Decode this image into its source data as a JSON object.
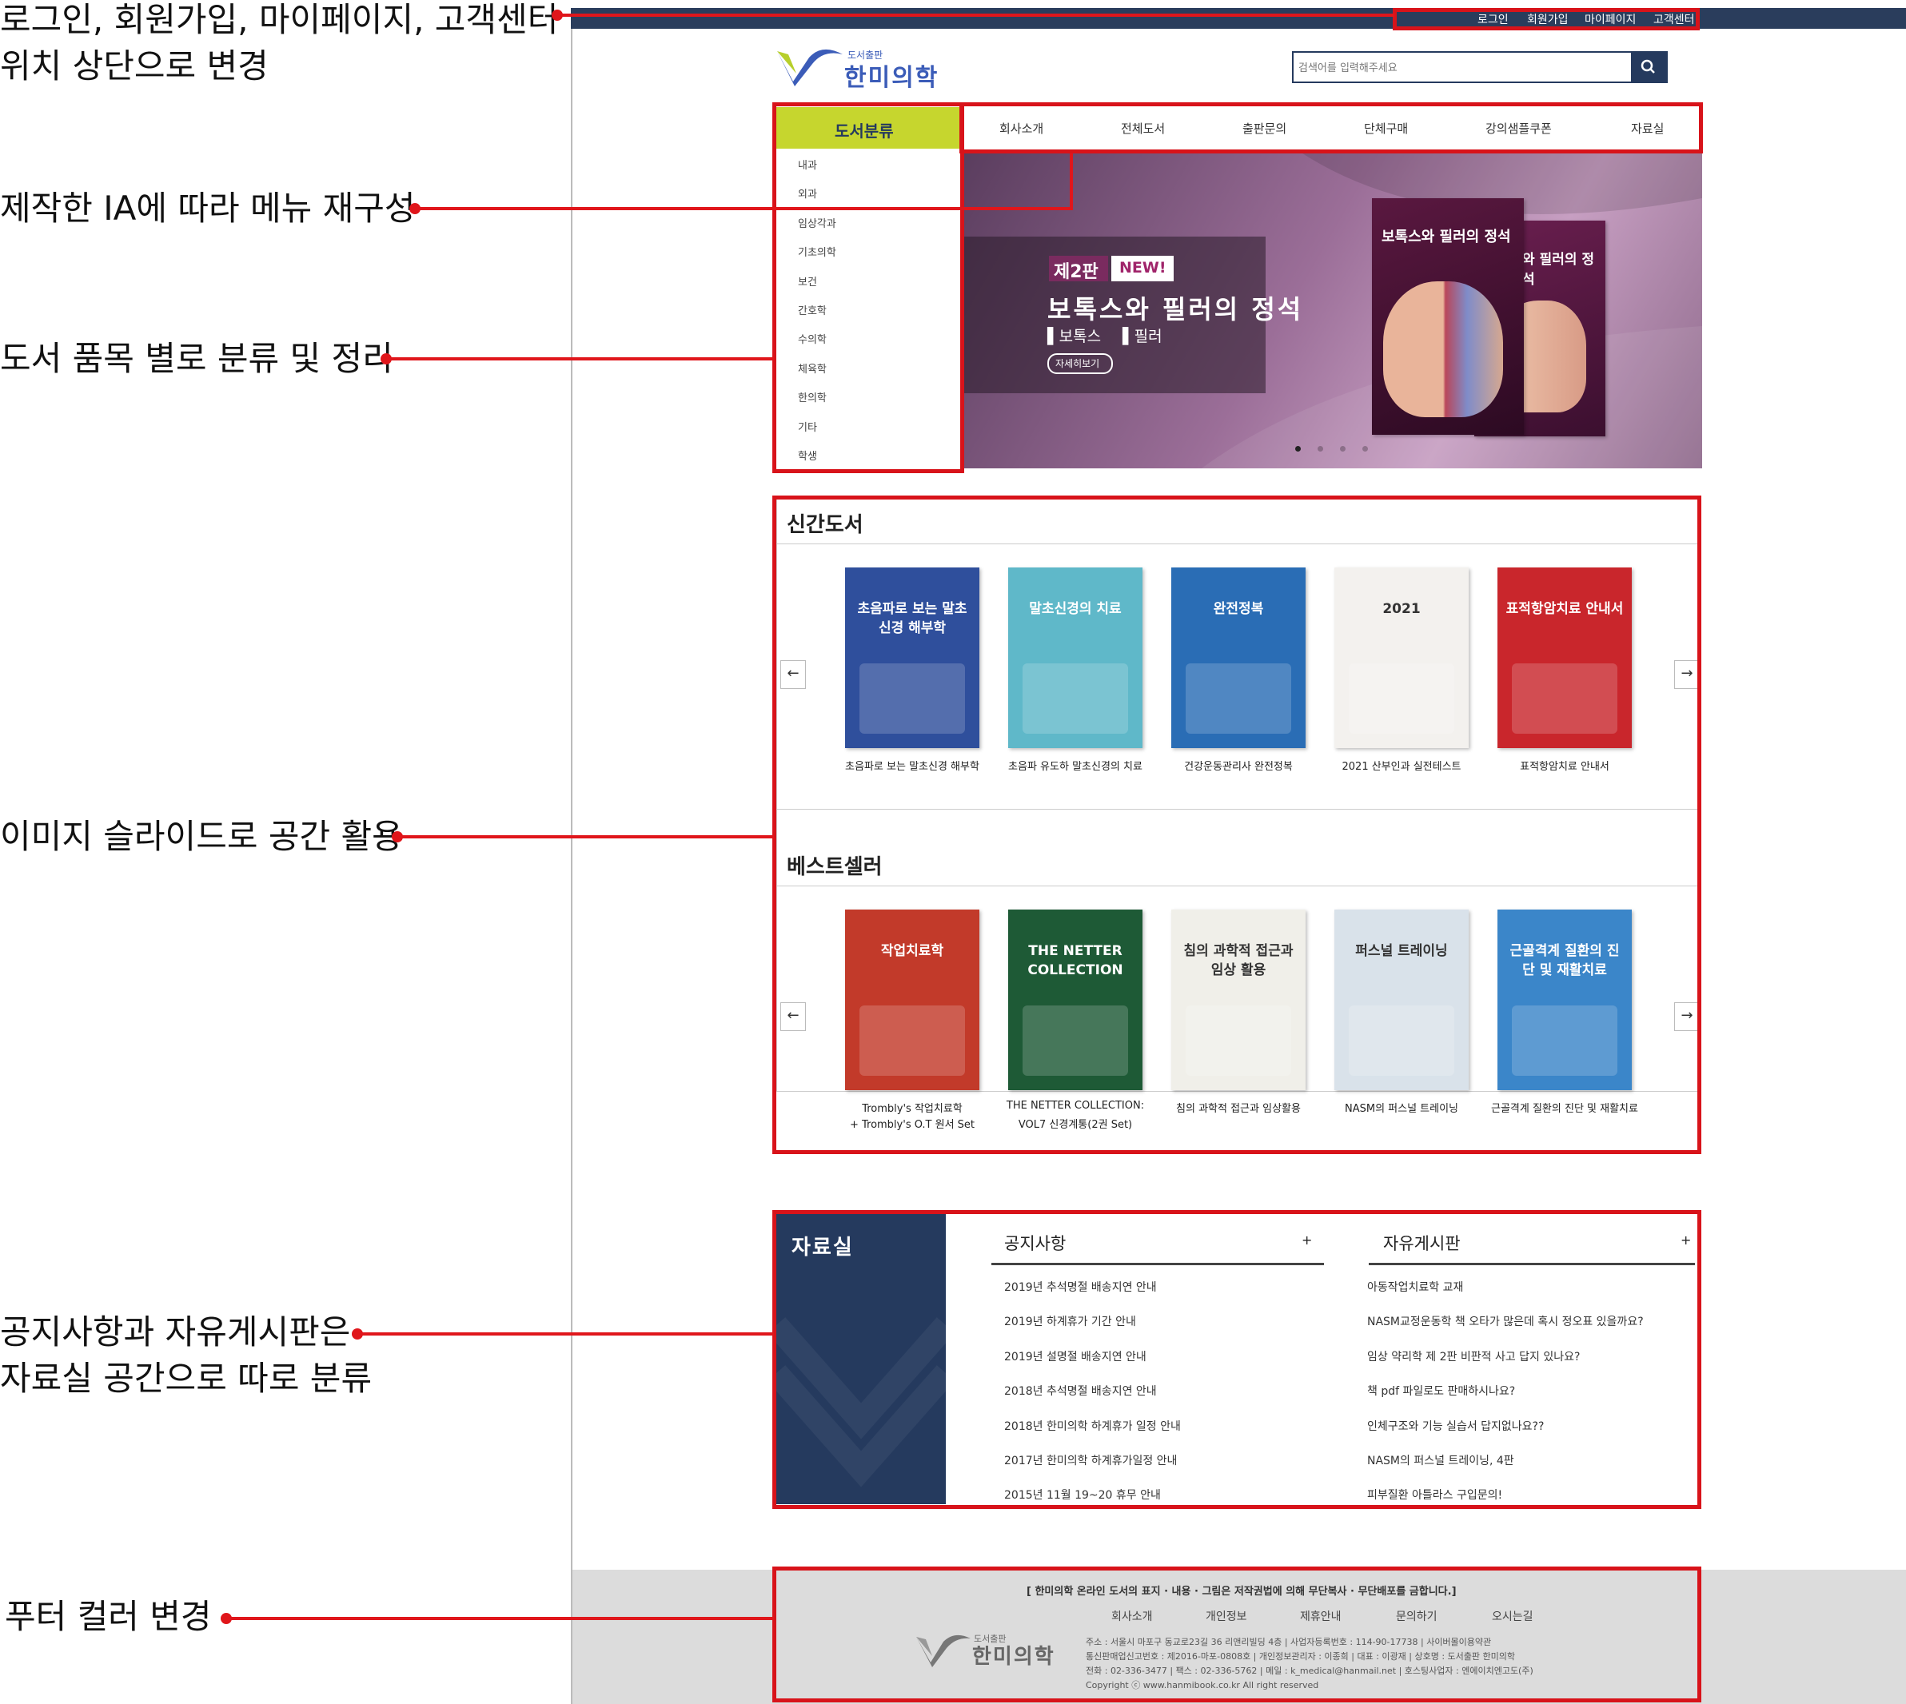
{
  "annotations": [
    {
      "lines": [
        "로그인, 회원가입, 마이페이지, 고객센터",
        "위치 상단으로 변경"
      ]
    },
    {
      "lines": [
        "제작한 IA에 따라 메뉴 재구성"
      ]
    },
    {
      "lines": [
        "도서 품목 별로 분류 및 정리"
      ]
    },
    {
      "lines": [
        "이미지 슬라이드로 공간 활용"
      ]
    },
    {
      "lines": [
        "공지사항과 자유게시판은",
        "자료실 공간으로 따로 분류"
      ]
    },
    {
      "lines": [
        "푸터 컬러 변경"
      ]
    }
  ],
  "top_links": [
    "로그인",
    "회원가입",
    "마이페이지",
    "고객센터"
  ],
  "logo": {
    "small": "도서출판",
    "main": "한미의학"
  },
  "search": {
    "placeholder": "검색어를 입력해주세요"
  },
  "category_header": "도서분류",
  "nav": [
    "회사소개",
    "전체도서",
    "출판문의",
    "단체구매",
    "강의샘플쿠폰",
    "자료실"
  ],
  "categories": [
    {
      "label": "내과",
      "plus": true
    },
    {
      "label": "외과",
      "plus": true
    },
    {
      "label": "임상각과",
      "plus": true
    },
    {
      "label": "기초의학",
      "plus": true
    },
    {
      "label": "보건",
      "plus": true
    },
    {
      "label": "간호학",
      "plus": false
    },
    {
      "label": "수의학",
      "plus": false
    },
    {
      "label": "체육학",
      "plus": true
    },
    {
      "label": "한의학",
      "plus": false
    },
    {
      "label": "기타",
      "plus": true
    },
    {
      "label": "학생",
      "plus": true
    }
  ],
  "banner": {
    "edition": "제2판",
    "new_badge": "NEW!",
    "title": "보톡스와 필러의 정석",
    "sub1": "보톡스",
    "sub2": "필러",
    "button": "자세히보기",
    "book_front_title": "보톡스와 필러의 정석",
    "book_back_title": "와 필러의 정석",
    "active_slide": 1,
    "slide_count": 4
  },
  "new_books": {
    "title": "신간도서",
    "items": [
      {
        "title": "초음파로 보는 말초신경 해부학",
        "cover_text": "초음파로 보는 말초신경 해부학",
        "color": "#2f4f9c"
      },
      {
        "title": "초음파 유도하 말초신경의 치료",
        "cover_text": "말초신경의 치료",
        "color": "#5fb8c9"
      },
      {
        "title": "건강운동관리사 완전정복",
        "cover_text": "완전정복",
        "color": "#2a6db5"
      },
      {
        "title": "2021 산부인과 실전테스트",
        "cover_text": "2021",
        "color": "#f3f1ee"
      },
      {
        "title": "표적항암치료 안내서",
        "cover_text": "표적항암치료 안내서",
        "color": "#c9262c"
      }
    ]
  },
  "best_books": {
    "title": "베스트셀러",
    "items": [
      {
        "title_line1": "Trombly's 작업치료학",
        "title_line2": "+ Trombly's O.T 원서 Set",
        "cover_text": "작업치료학",
        "color": "#c23a2a"
      },
      {
        "title_line1": "THE NETTER COLLECTION:",
        "title_line2": "VOL7 신경계통(2권 Set)",
        "cover_text": "THE NETTER COLLECTION",
        "color": "#1e5a36"
      },
      {
        "title_line1": "침의 과학적 접근과 임상활용",
        "title_line2": "",
        "cover_text": "침의 과학적 접근과 임상 활용",
        "color": "#f0efe9"
      },
      {
        "title_line1": "NASM의 퍼스널 트레이닝",
        "title_line2": "",
        "cover_text": "퍼스널 트레이닝",
        "color": "#d9e2ea"
      },
      {
        "title_line1": "근골격계 질환의 진단 및 재활치료",
        "title_line2": "",
        "cover_text": "근골격계 질환의 진단 및 재활치료",
        "color": "#3b86c9"
      }
    ]
  },
  "archive": {
    "title": "자료실",
    "notice_title": "공지사항",
    "board_title": "자유게시판",
    "more": "+",
    "notices": [
      "2019년 추석명절 배송지연 안내",
      "2019년 하계휴가 기간 안내",
      "2019년 설명절 배송지연 안내",
      "2018년 추석명절 배송지연 안내",
      "2018년 한미의학 하계휴가 일정 안내",
      "2017년 한미의학 하계휴가일정 안내",
      "2015년 11월 19~20 휴무 안내"
    ],
    "posts": [
      "아동작업치료학 교재",
      "NASM교정운동학 책 오타가 많은데 혹시 정오표 있을까요?",
      "임상 약리학 제 2판 비판적 사고 답지 있나요?",
      "책 pdf 파일로도 판매하시나요?",
      "인체구조와 기능 실습서 답지없나요??",
      "NASM의 퍼스널 트레이닝, 4판",
      "피부질환 아틀라스 구입문의!"
    ]
  },
  "footer": {
    "notice": "[ 한미의학 온라인 도서의 표지 · 내용 · 그림은 저작권법에 의해 무단복사 · 무단배포를 금합니다.]",
    "links": [
      "회사소개",
      "개인정보",
      "제휴안내",
      "문의하기",
      "오시는길"
    ],
    "logo_small": "도서출판",
    "logo_main": "한미의학",
    "info_lines": [
      "주소 : 서울시 마포구 동교로23길 36 리앤리빌딩 4층 | 사업자등록번호 : 114-90-17738 | 사이버몰이용약관",
      "통신판매업신고번호 : 제2016-마포-0808호 | 개인정보관리자 : 이종희 | 대표 : 이광재 | 상호명 : 도서출판 한미의학",
      "전화 : 02-336-3477 | 팩스 : 02-336-5762 | 메일 : k_medical@hanmail.net | 호스팅사업자 : 엔에이치엔고도(주)",
      "Copyright ⓒ www.hanmibook.co.kr All right reserved"
    ]
  },
  "colors": {
    "accent_red": "#d8131a",
    "navy": "#253a5e",
    "lime": "#c6d62e",
    "footer_bg": "#dcdcdc"
  }
}
